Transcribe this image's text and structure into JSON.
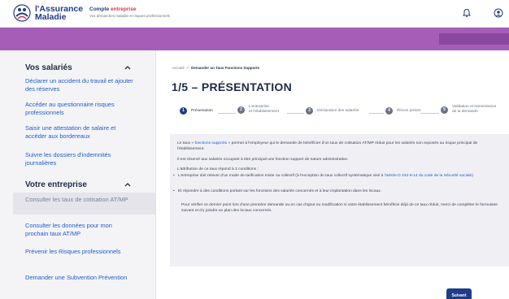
{
  "header": {
    "logo_line1": "l'Assurance",
    "logo_line2": "Maladie",
    "account_title_main": "Compte",
    "account_title_accent": "entreprise",
    "account_subtitle": "Vos démarches maladie et risques professionnels",
    "bell_icon": "bell-icon",
    "user_icon": "user-icon"
  },
  "sidebar": {
    "section1_title": "Vos salariés",
    "section1_items": [
      "Déclarer un accident du travail et ajouter des réserves",
      "Accéder au questionnaire risques professionnels",
      "Saisir une attestation de salaire et accéder aux bordereaux",
      "Suivre les dossiers d'indemnités journalières"
    ],
    "section2_title": "Votre entreprise",
    "section2_items": [
      "Consulter les taux de cotisation AT/MP",
      "Consulter les données pour mon prochain taux AT/MP",
      "Prévenir les Risques professionnels",
      "Demander une Subvention Prévention"
    ]
  },
  "breadcrumb": {
    "home": "Accueil",
    "separator": ">",
    "current": "Demander un Taux Fonctions Supports"
  },
  "page_title": "1/5 – PRÉSENTATION",
  "steps": [
    {
      "num": "1",
      "label": "Présentation"
    },
    {
      "num": "2",
      "label": "L'entreprise\net l'établissement"
    },
    {
      "num": "3",
      "label": "Déclaration des salariés"
    },
    {
      "num": "4",
      "label": "Pièces jointes"
    },
    {
      "num": "5",
      "label": "Validation et transmission\nde la demande"
    }
  ],
  "panel": {
    "p1_before": "Le taux « ",
    "p1_link": "fonctions supports",
    "p1_after": " » permet à l'employeur qui le demande de bénéficier d'un taux de cotisation AT/MP réduit pour les salariés non exposés au risque principal de l'établissement.",
    "p2": "Il est réservé aux salariés occupant à titre principal une fonction support de nature administrative.",
    "p3": "L'attribution de ce taux répond à 2 conditions :",
    "b1_before": "L'entreprise doit relever d'un mode de tarification mixte ou collectif (à l'exception du taux collectif systématique visé à ",
    "b1_link": "l'article D 242-6-14 du code de la Sécurité sociale",
    "b1_after": ")",
    "b2": "Et répondre à des conditions portant sur les fonctions des salariés concernés et à leur implantation dans les locaux.",
    "p4": "Pour vérifier ce dernier point lors d'une première demande ou en cas d'ajout ou modification si votre établissement bénéficie déjà de ce taux réduit, merci de compléter le formulaire suivant et d'y joindre un plan des locaux concernés."
  },
  "next_button": "Suivant",
  "colors": {
    "brand_blue": "#1f3c88",
    "accent_red": "#d9324f",
    "purple_band": "#a55db7",
    "link_blue": "#1f5bd1"
  }
}
